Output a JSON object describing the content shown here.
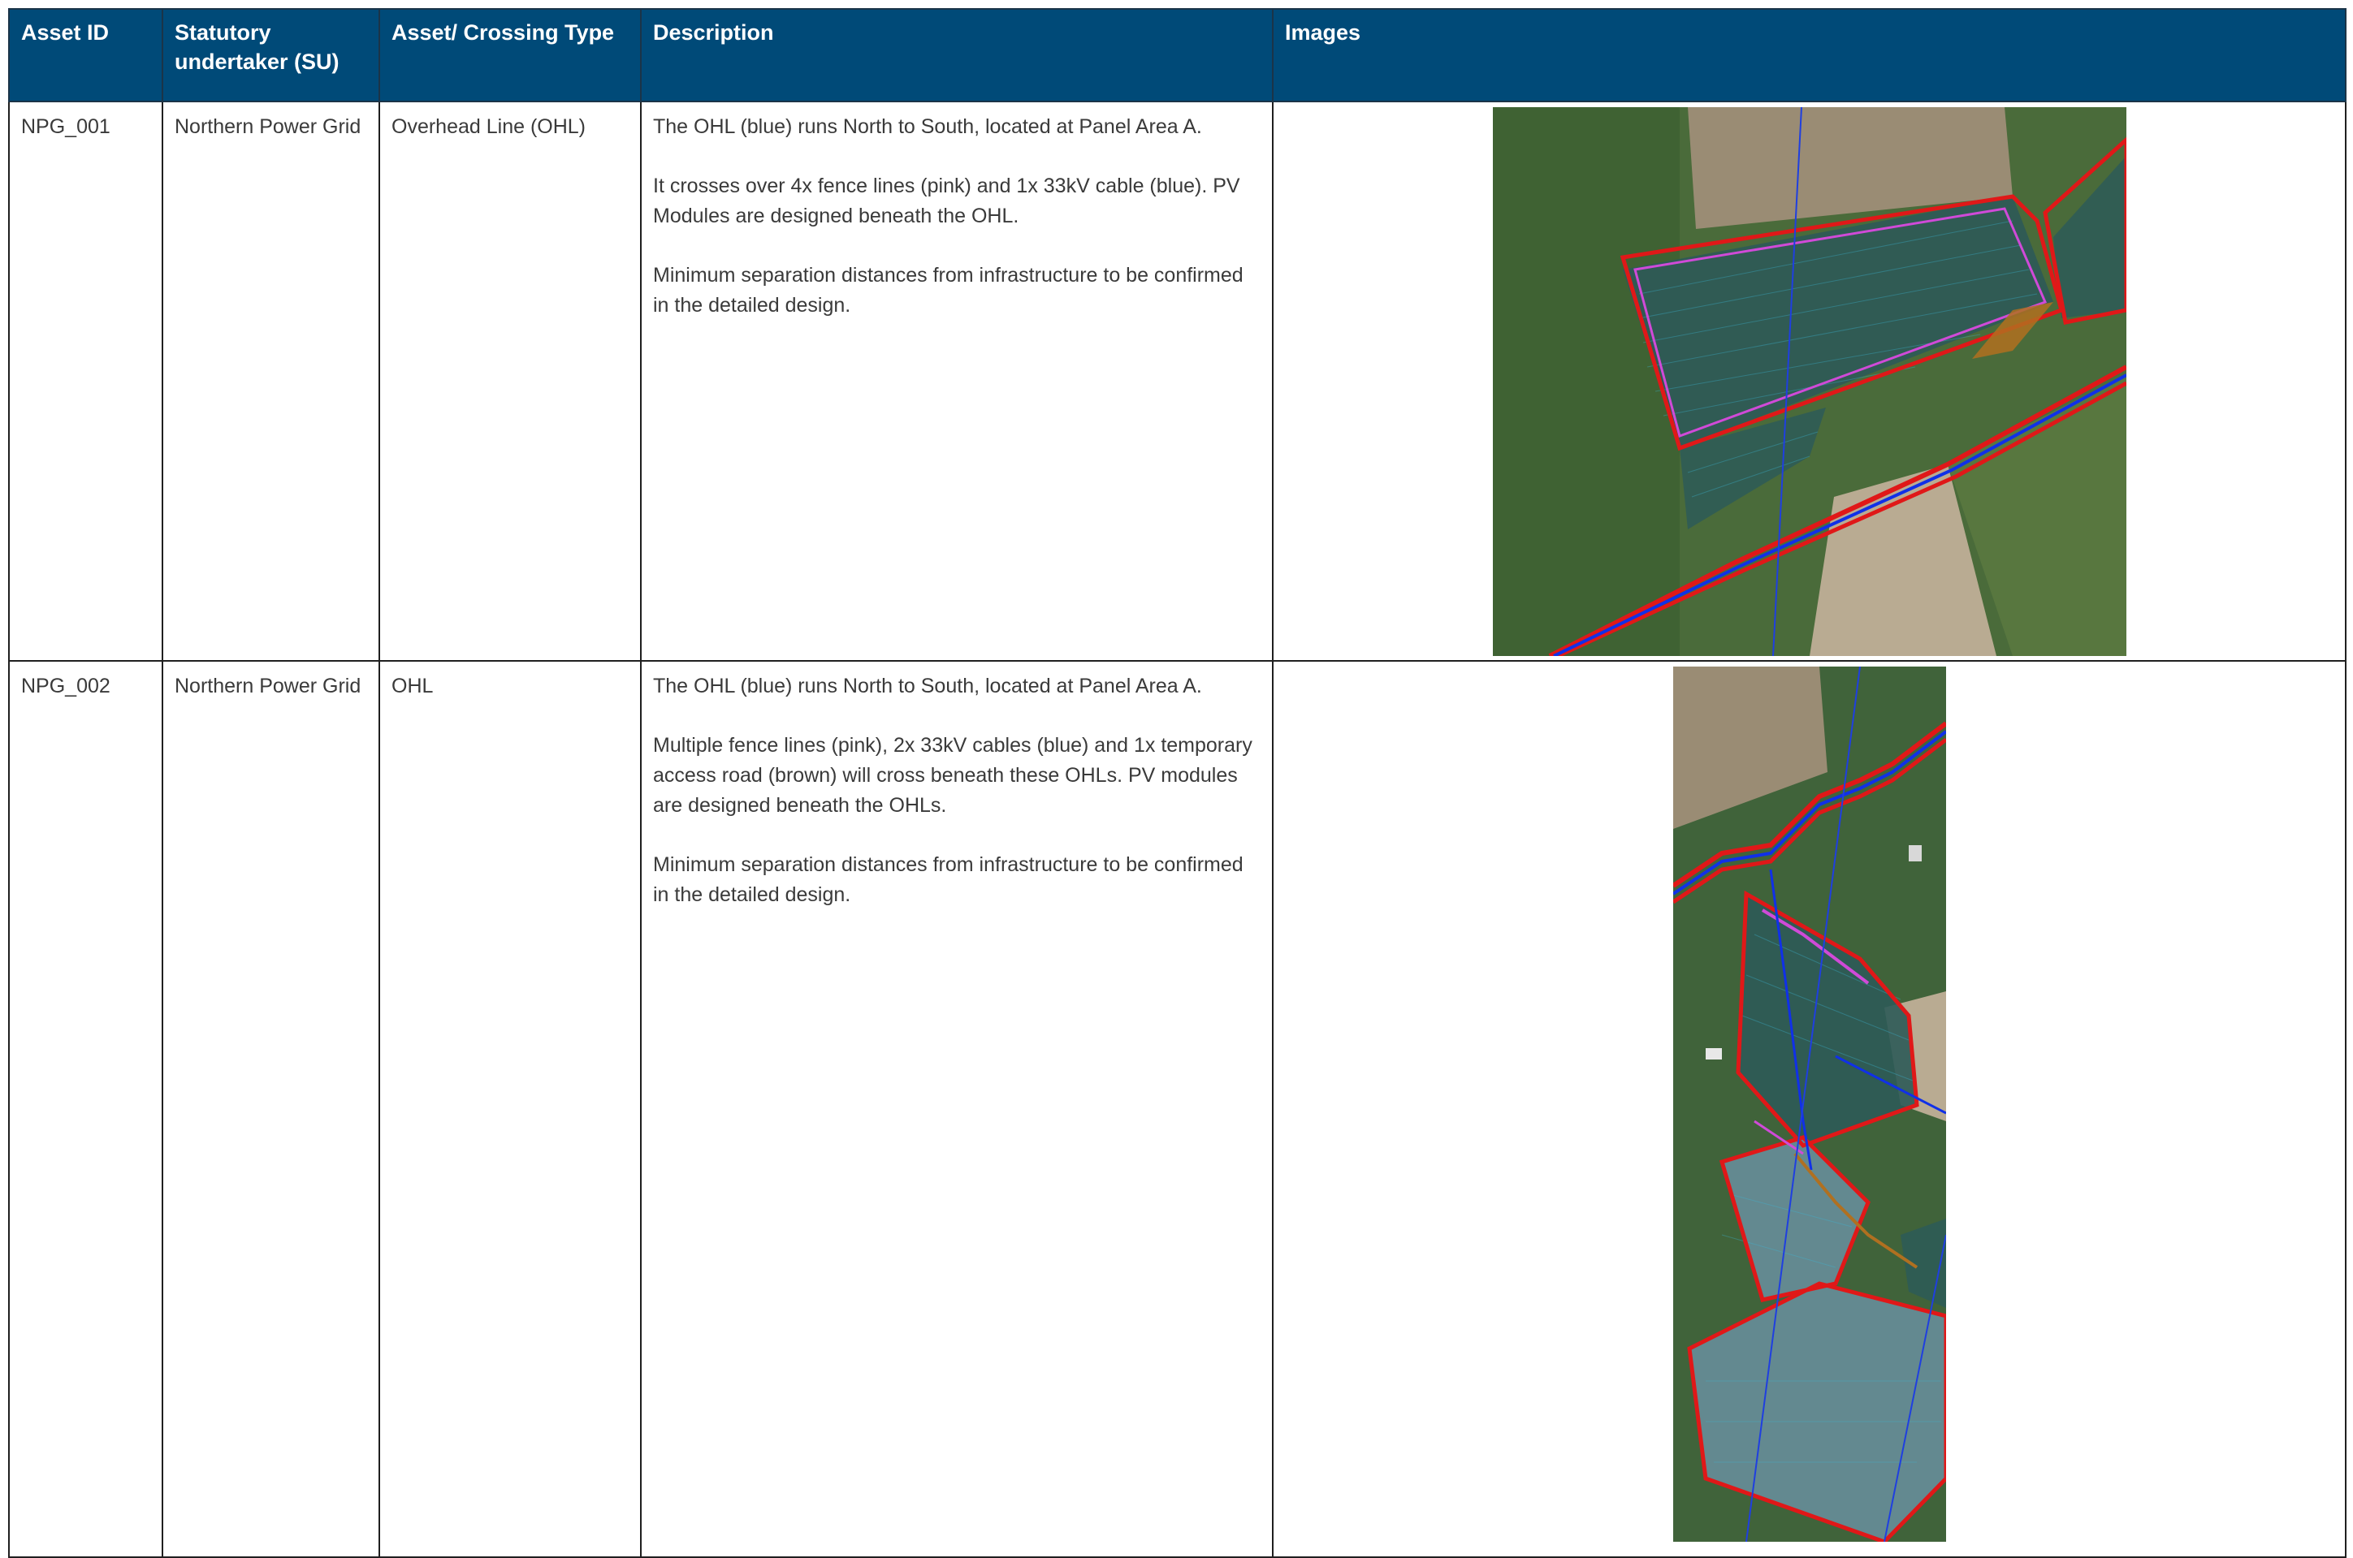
{
  "table": {
    "headers": [
      "Asset ID",
      "Statutory undertaker (SU)",
      "Asset/ Crossing Type",
      "Description",
      "Images"
    ],
    "rows": [
      {
        "asset_id": "NPG_001",
        "su": "Northern Power Grid",
        "type": "Overhead Line (OHL)",
        "description": [
          "The OHL (blue) runs North to South, located at Panel Area A.",
          "It crosses over 4x fence lines (pink) and 1x 33kV cable (blue). PV Modules are designed beneath the OHL.",
          "Minimum separation distances from infrastructure to be confirmed in the detailed design."
        ]
      },
      {
        "asset_id": "NPG_002",
        "su": "Northern Power Grid",
        "type": "OHL",
        "description": [
          "The OHL (blue) runs North to South, located at Panel Area A.",
          "Multiple fence lines (pink), 2x 33kV cables (blue) and 1x temporary access road (brown) will cross beneath these OHLs. PV modules are designed beneath the OHLs.",
          "Minimum separation distances from infrastructure to be confirmed in the detailed design."
        ]
      }
    ]
  },
  "colors": {
    "header_bg": "#004a78",
    "header_text": "#ffffff",
    "ohl_line": "#1f3fe0",
    "fence_line": "#d04ad8",
    "boundary": "#e01818",
    "cable": "#1030e8",
    "access_road": "#b07020",
    "field_green": "#3d5c2e"
  }
}
